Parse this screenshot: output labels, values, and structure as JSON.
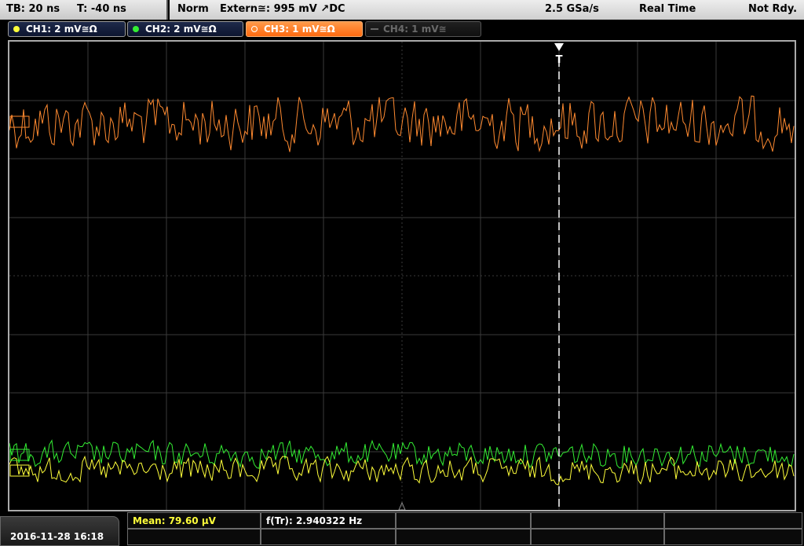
{
  "status": {
    "timebase": "TB: 20 ns",
    "trigger_time": "T: -40 ns",
    "mode": "Norm",
    "trigger_source": "Extern≅: 995 mV ↗DC",
    "sample_rate": "2.5 GSa/s",
    "acq_mode": "Real Time",
    "state": "Not Rdy."
  },
  "channels": [
    {
      "label": "CH1: 2 mV≅Ω",
      "color": "#ffff3a",
      "state": "on"
    },
    {
      "label": "CH2: 2 mV≅Ω",
      "color": "#33ee33",
      "state": "on"
    },
    {
      "label": "CH3: 1 mV≅Ω",
      "color": "#ff8a30",
      "state": "active"
    },
    {
      "label": "CH4: 1 mV≅",
      "color": "#777777",
      "state": "off"
    }
  ],
  "trigger_marker": "T",
  "measurements": {
    "mean": "Mean: 79.60 µV",
    "freq": "f(Tr): 2.940322 Hz"
  },
  "datetime": "2016-11-28 16:18",
  "colors": {
    "ch1": "#ffff3a",
    "ch2": "#33ee33",
    "ch3": "#ff8a30",
    "grid": "#3a3a3a"
  }
}
